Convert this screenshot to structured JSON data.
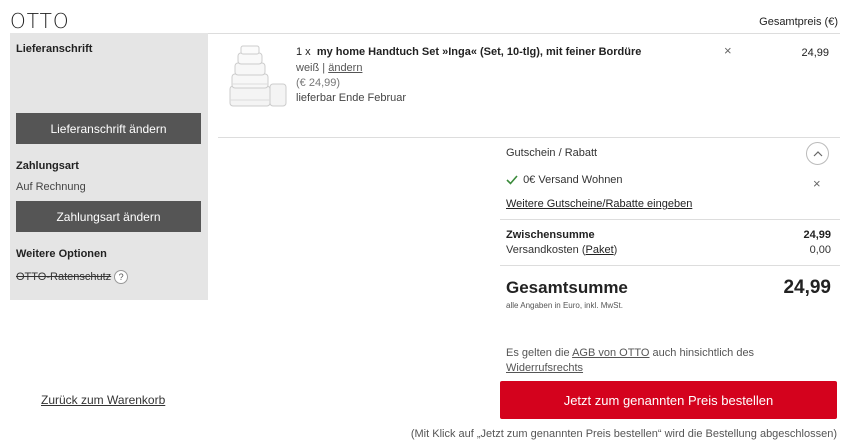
{
  "header": {
    "logo": "OTTO",
    "total_label": "Gesamtpreis (€)"
  },
  "sidebar": {
    "address_heading": "Lieferanschrift",
    "address_button": "Lieferanschrift ändern",
    "payment_heading": "Zahlungsart",
    "payment_value": "Auf Rechnung",
    "payment_button": "Zahlungsart ändern",
    "options_heading": "Weitere Optionen",
    "option_item": "OTTO-Ratenschutz",
    "option_help": "?"
  },
  "item": {
    "qty": "1 x",
    "title": "my home Handtuch Set »Inga« (Set, 10-tlg), mit feiner Bordüre",
    "color": "weiß |",
    "change_link": "ändern",
    "unit_price": "(€ 24,99)",
    "delivery": "lieferbar Ende Februar",
    "price": "24,99",
    "remove": "×"
  },
  "coupon": {
    "heading": "Gutschein / Rabatt",
    "applied": "0€ Versand Wohnen",
    "more_link": "Weitere Gutscheine/Rabatte eingeben"
  },
  "summary": {
    "subtotal_label": "Zwischensumme",
    "subtotal_value": "24,99",
    "shipping_label": "Versandkosten (",
    "shipping_link": "Paket",
    "shipping_close": ")",
    "shipping_value": "0,00",
    "total_label": "Gesamtsumme",
    "total_value": "24,99",
    "total_note": "alle Angaben in Euro, inkl. MwSt."
  },
  "terms": {
    "prefix": "Es gelten die ",
    "agb_link": "AGB von OTTO",
    "middle": " auch hinsichtlich des",
    "widerruf_link": "Widerrufsrechts"
  },
  "actions": {
    "back_link": "Zurück zum Warenkorb",
    "order_button": "Jetzt zum genannten Preis bestellen",
    "order_note": "(Mit Klick auf „Jetzt zum genannten Preis bestellen“ wird die Bestellung abgeschlossen)"
  }
}
